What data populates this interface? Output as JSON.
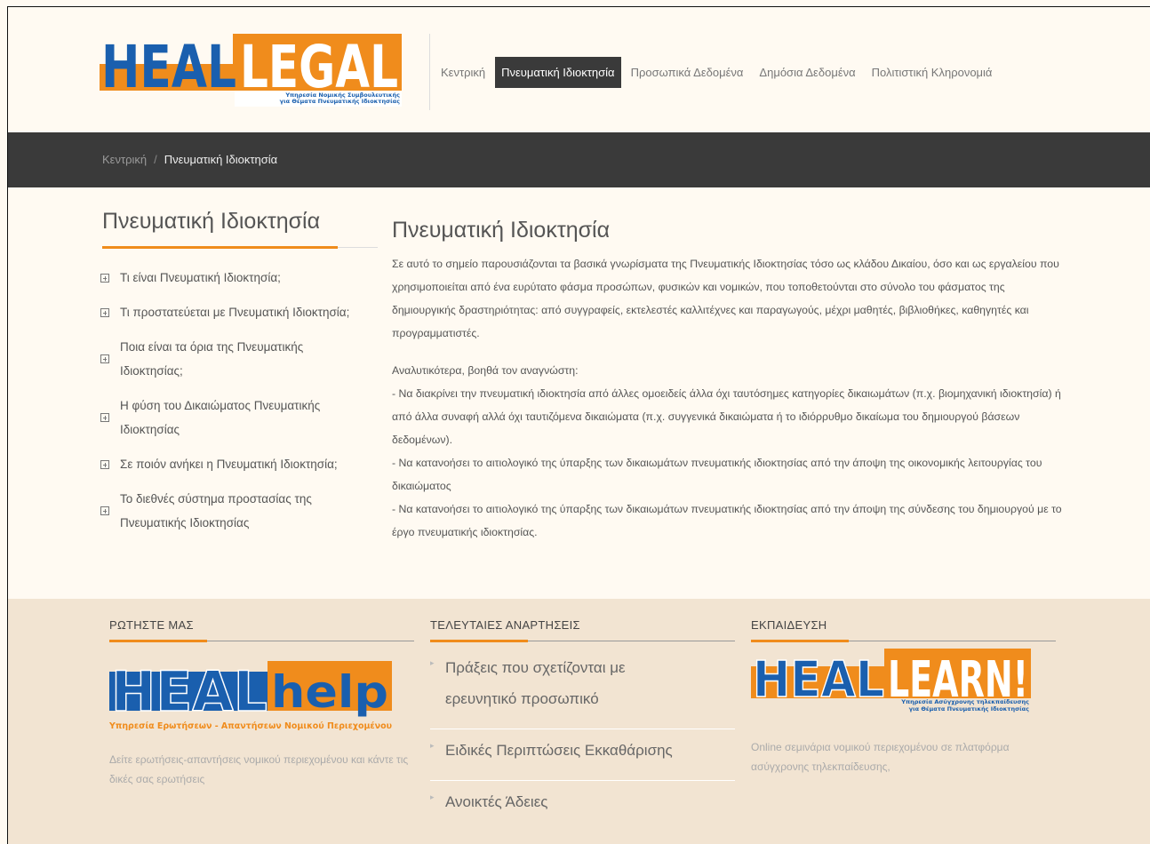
{
  "header": {
    "logo": {
      "word_left": "HEAL",
      "word_right": "LEGAL",
      "subtitle_line1": "Υπηρεσία Νομικής Συμβουλευτικής",
      "subtitle_line2": "για Θέματα Πνευματικής Ιδιοκτησίας"
    },
    "nav": [
      {
        "label": "Κεντρική",
        "active": false
      },
      {
        "label": "Πνευματική Ιδιοκτησία",
        "active": true
      },
      {
        "label": "Προσωπικά Δεδομένα",
        "active": false
      },
      {
        "label": "Δημόσια Δεδομένα",
        "active": false
      },
      {
        "label": "Πολιτιστική Κληρονομιά",
        "active": false
      }
    ]
  },
  "breadcrumb": {
    "home": "Κεντρική",
    "separator": "/",
    "current": "Πνευματική Ιδιοκτησία"
  },
  "sidebar": {
    "title": "Πνευματική Ιδιοκτησία",
    "items": [
      {
        "label": "Τι είναι Πνευματική Ιδιοκτησία;"
      },
      {
        "label": "Τι προστατεύεται με Πνευματική Ιδιοκτησία;"
      },
      {
        "label": "Ποια είναι τα όρια της Πνευματικής Ιδιοκτησίας;"
      },
      {
        "label": "Η φύση του Δικαιώματος Πνευματικής Ιδιοκτησίας"
      },
      {
        "label": "Σε ποιόν ανήκει η Πνευματική Ιδιοκτησία;"
      },
      {
        "label": "Το διεθνές σύστημα προστασίας της Πνευματικής Ιδιοκτησίας"
      }
    ]
  },
  "content": {
    "title": "Πνευματική Ιδιοκτησία",
    "intro": "Σε αυτό το σημείο παρουσιάζονται τα βασικά γνωρίσματα της Πνευματικής Ιδιοκτησίας τόσο ως κλάδου Δικαίου, όσο και ως εργαλείου που χρησιμοποιείται από ένα ευρύτατο φάσμα προσώπων, φυσικών και νομικών, που τοποθετούνται στο σύνολο του φάσματος της δημιουργικής δραστηριότητας: από συγγραφείς, εκτελεστές καλλιτέχνες και παραγωγούς, μέχρι μαθητές, βιβλιοθήκες, καθηγητές και προγραμματιστές.",
    "lead": "Αναλυτικότερα, βοηθά τον αναγνώστη:",
    "points": [
      "- Να διακρίνει την πνευματική ιδιοκτησία από άλλες ομοειδείς άλλα όχι ταυτόσημες κατηγορίες δικαιωμάτων (π.χ. βιομηχανική ιδιοκτησία) ή από άλλα συναφή αλλά όχι ταυτιζόμενα δικαιώματα (π.χ. συγγενικά δικαιώματα ή το ιδιόρρυθμο δικαίωμα του δημιουργού βάσεων δεδομένων).",
      "- Να κατανοήσει το αιτιολογικό της ύπαρξης των δικαιωμάτων πνευματικής ιδιοκτησίας από την άποψη της οικονομικής λειτουργίας του δικαιώματος",
      "- Να κατανοήσει το αιτιολογικό της ύπαρξης των δικαιωμάτων πνευματικής ιδιοκτησίας από την άποψη της σύνδεσης του δημιουργού με το έργο πνευματικής ιδιοκτησίας."
    ]
  },
  "footer": {
    "ask": {
      "heading": "ΡΩΤΗΣΤΕ ΜΑΣ",
      "logo_left": "HEAL",
      "logo_right": "help",
      "logo_tagline": "Υπηρεσία Ερωτήσεων - Απαντήσεων Νομικού Περιεχομένου",
      "text": "Δείτε ερωτήσεις-απαντήσεις νομικού περιεχομένου και κάντε τις δικές σας ερωτήσεις"
    },
    "latest": {
      "heading": "ΤΕΛΕΥΤΑΙΕΣ ΑΝΑΡΤΗΣΕΙΣ",
      "posts": [
        {
          "title": "Πράξεις που σχετίζονται με ερευνητικό προσωπικό"
        },
        {
          "title": "Ειδικές Περιπτώσεις Εκκαθάρισης"
        },
        {
          "title": "Ανοικτές Άδειες"
        }
      ]
    },
    "education": {
      "heading": "ΕΚΠΑΙΔΕΥΣΗ",
      "logo_left": "HEAL",
      "logo_right": "LEARN!",
      "subtitle_line1": "Υπηρεσία Ασύγχρονης τηλεκπαίδευσης",
      "subtitle_line2": "για Θέματα Πνευματικής Ιδιοκτησίας",
      "text": "Online σεμινάρια νομικού περιεχομένου σε πλατφόρμα ασύγχρονης τηλεκπαίδευσης,"
    }
  },
  "colors": {
    "brand_blue": "#1a5fae",
    "brand_orange": "#f08c1c",
    "dark_bar": "#3a3a3a",
    "footer_bg": "#f2e4d2"
  }
}
